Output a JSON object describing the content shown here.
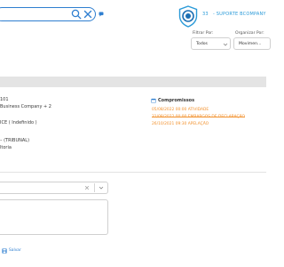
{
  "header": {
    "app_number": "33",
    "app_title": "- SUPORTE BCOMPANY"
  },
  "filters": {
    "filter_label": "Filtrar Por:",
    "filter_value": "Todos",
    "organize_label": "Organizar Por:",
    "organize_value": "Movimen..."
  },
  "detail": {
    "line1": "101",
    "line2": "Business Company + 2",
    "line3": "ICE ( Indefinido )",
    "line4": "– (TRIBUNAL)",
    "line5": "ltoria"
  },
  "compromissos": {
    "title": "Compromissos",
    "items": [
      "05/08/2022 00:00 ATIVIDADE",
      "31/08/2022 00:00 EMBARGOS DE DECLARAÇÃO",
      "26/10/2021 09:30 APELAÇÃO"
    ]
  },
  "form": {
    "save_label": "Salvar"
  },
  "colors": {
    "accent": "#2a9ad8",
    "link": "#2f7fd0",
    "highlight": "#f2922f",
    "band": "#e4e4e4"
  },
  "icons": [
    "search-icon",
    "close-icon",
    "chat-icon",
    "logo-icon",
    "chevron-down-icon",
    "calendar-icon",
    "clear-icon",
    "save-icon"
  ]
}
